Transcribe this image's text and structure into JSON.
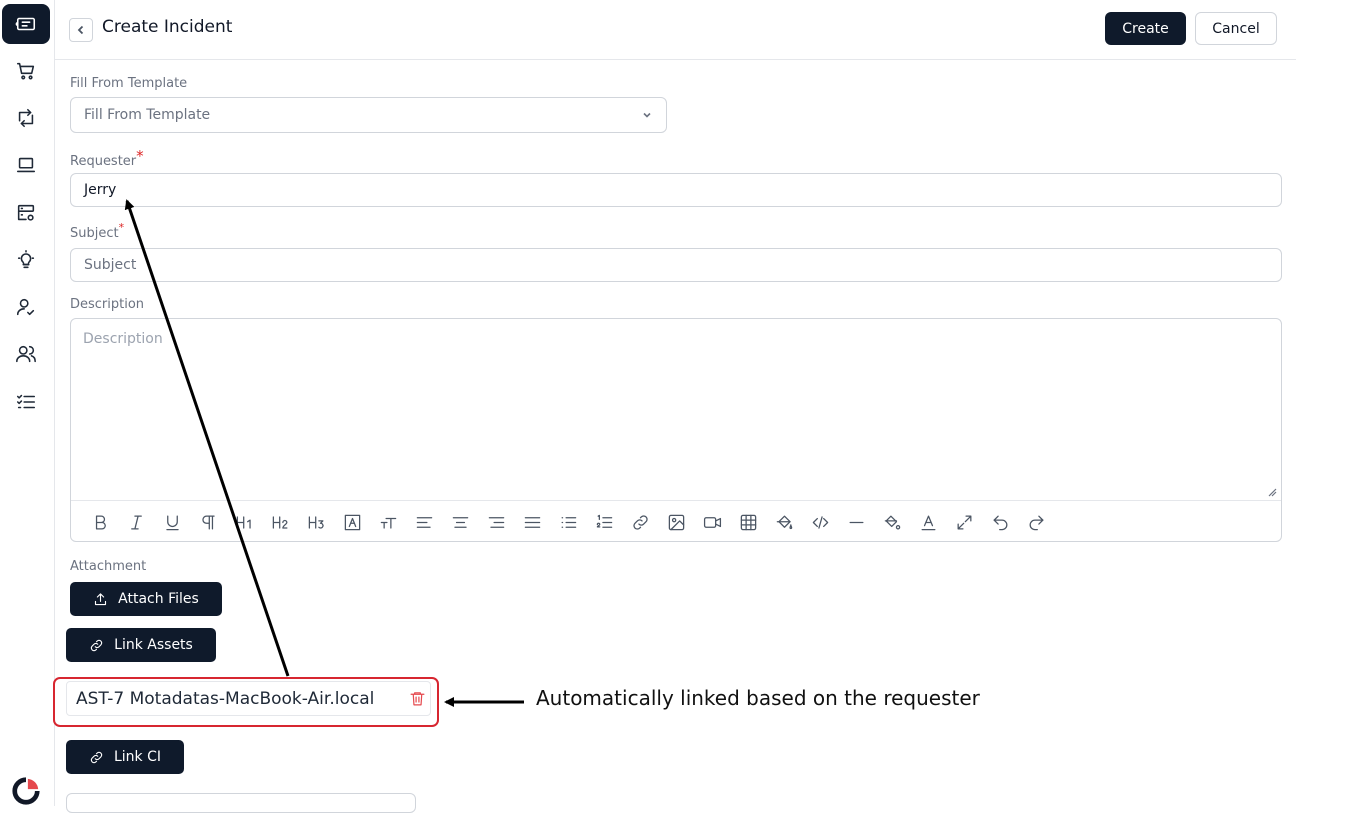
{
  "header": {
    "title": "Create Incident",
    "create_label": "Create",
    "cancel_label": "Cancel"
  },
  "sidebar": {
    "items": [
      {
        "icon": "ticket-icon",
        "active": true
      },
      {
        "icon": "cart-icon",
        "active": false
      },
      {
        "icon": "change-icon",
        "active": false
      },
      {
        "icon": "laptop-icon",
        "active": false
      },
      {
        "icon": "server-settings-icon",
        "active": false
      },
      {
        "icon": "lightbulb-icon",
        "active": false
      },
      {
        "icon": "user-check-icon",
        "active": false
      },
      {
        "icon": "users-icon",
        "active": false
      },
      {
        "icon": "task-list-icon",
        "active": false
      }
    ],
    "logo_icon": "brand-logo-icon"
  },
  "form": {
    "template_label": "Fill From Template",
    "template_placeholder": "Fill From Template",
    "requester_label": "Requester",
    "requester_required": "*",
    "requester_value": "Jerry",
    "subject_label": "Subject",
    "subject_required": "*",
    "subject_placeholder": "Subject",
    "description_label": "Description",
    "description_placeholder": "Description",
    "attachment_label": "Attachment",
    "attach_files_label": "Attach Files",
    "link_assets_label": "Link Assets",
    "linked_asset": "AST-7 Motadatas-MacBook-Air.local",
    "link_ci_label": "Link CI"
  },
  "toolbar": {
    "buttons": [
      "bold",
      "italic",
      "underline",
      "paragraph",
      "heading-1",
      "heading-2",
      "heading-3",
      "font-box",
      "text-size",
      "align-left",
      "align-center",
      "align-right",
      "align-justify",
      "bullet-list",
      "numbered-list",
      "link",
      "image",
      "video",
      "table",
      "paint-bucket",
      "code",
      "horizontal-rule",
      "highlight",
      "font-color",
      "fullscreen",
      "undo",
      "redo"
    ]
  },
  "annotation": {
    "text": "Automatically linked based on the requester"
  },
  "colors": {
    "primary": "#0f1a2b",
    "highlight_box": "#d72630",
    "trash": "#e5484d",
    "required": "#dc2626"
  }
}
